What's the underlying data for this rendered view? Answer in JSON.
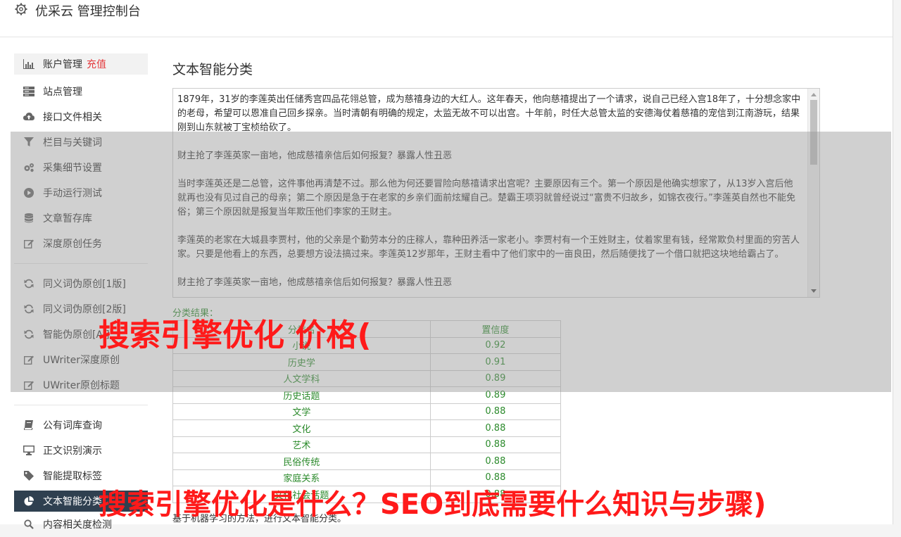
{
  "header": {
    "title": "优采云 管理控制台",
    "icon": "gear-icon"
  },
  "sidebar": {
    "group1": [
      {
        "label": "账户管理",
        "badge": "充值",
        "icon": "bar-chart-icon"
      },
      {
        "label": "站点管理",
        "icon": "server-icon"
      },
      {
        "label": "接口文件相关",
        "icon": "cloud-upload-icon"
      },
      {
        "label": "栏目与关键词",
        "icon": "filter-icon"
      },
      {
        "label": "采集细节设置",
        "icon": "cogs-icon"
      },
      {
        "label": "手动运行测试",
        "icon": "play-circle-icon"
      },
      {
        "label": "文章暂存库",
        "icon": "database-icon"
      },
      {
        "label": "深度原创任务",
        "icon": "edit-icon"
      }
    ],
    "group2": [
      {
        "label": "同义词伪原创[1版]",
        "icon": "refresh-icon"
      },
      {
        "label": "同义词伪原创[2版]",
        "icon": "refresh-icon"
      },
      {
        "label": "智能伪原创[AI]",
        "icon": "refresh-icon"
      },
      {
        "label": "UWriter深度原创",
        "icon": "edit-icon"
      },
      {
        "label": "UWriter原创标题",
        "icon": "edit-icon"
      }
    ],
    "group3": [
      {
        "label": "公有词库查询",
        "icon": "book-icon"
      },
      {
        "label": "正文识别演示",
        "icon": "desktop-icon"
      },
      {
        "label": "智能提取标签",
        "icon": "tag-icon"
      },
      {
        "label": "文本智能分类",
        "icon": "pie-chart-icon"
      },
      {
        "label": "内容相关度检测",
        "icon": "search-icon"
      }
    ]
  },
  "main": {
    "title": "文本智能分类",
    "paragraphs": [
      "1879年，31岁的李莲英出任储秀宫四品花翎总管，成为慈禧身边的大红人。这年春天，他向慈禧提出了一个请求，说自己已经入宫18年了，十分想念家中的老母，希望可以恩准自己回乡探亲。当时清朝有明确的规定，太监无故不可以出宫。十年前，时任大总管太监的安德海仗着慈禧的宠信到江南游玩，结果刚到山东就被丁宝桢给砍了。",
      "财主抢了李莲英家一亩地，他成慈禧亲信后如何报复？暴露人性丑恶",
      "当时李莲英还是二总管，这件事他再清楚不过。那么他为何还要冒险向慈禧请求出宫呢？主要原因有三个。第一个原因是他确实想家了，从13岁入宫后他就再也没有见过自己的母亲；第二个原因是急于在老家的乡亲们面前炫耀自己。楚霸王项羽就曾经说过“富贵不归故乡，如锦衣夜行。”李莲英自然也不能免俗；第三个原因就是报复当年欺压他们李家的王财主。",
      "李莲英的老家在大城县李贾村，他的父亲是个勤劳本分的庄稼人，靠种田养活一家老小。李贾村有一个王姓财主，仗着家里有钱，经常欺负村里面的穷苦人家。只要是他看上的东西，总要想方设法搞过来。李莲英12岁那年，王财主看中了他们家中的一亩良田，然后随便找了一个借口就把这块地给霸占了。",
      "财主抢了李莲英家一亩地，他成慈禧亲信后如何报复？暴露人性丑恶"
    ],
    "result_label": "分类结果：",
    "table": {
      "headers": [
        "分类名",
        "置信度"
      ],
      "rows": [
        [
          "小说",
          "0.92"
        ],
        [
          "历史学",
          "0.91"
        ],
        [
          "人文学科",
          "0.89"
        ],
        [
          "历史话题",
          "0.89"
        ],
        [
          "文学",
          "0.88"
        ],
        [
          "文化",
          "0.88"
        ],
        [
          "艺术",
          "0.88"
        ],
        [
          "民俗传统",
          "0.88"
        ],
        [
          "家庭关系",
          "0.88"
        ],
        [
          "文化社会话题",
          "0.88"
        ]
      ]
    },
    "description": "基于机器学习的方法，进行文本智能分类。"
  },
  "overlay_text": {
    "line1": "搜索引擎优化 价格(",
    "line2": "搜索引擎优化是什么？SEO到底需要什么知识与步骤)"
  },
  "colors": {
    "accent_green": "#2b8a2b",
    "active_nav": "#2f4050",
    "badge_red": "#e4393c",
    "overlay_red": "#ff1a1a"
  }
}
